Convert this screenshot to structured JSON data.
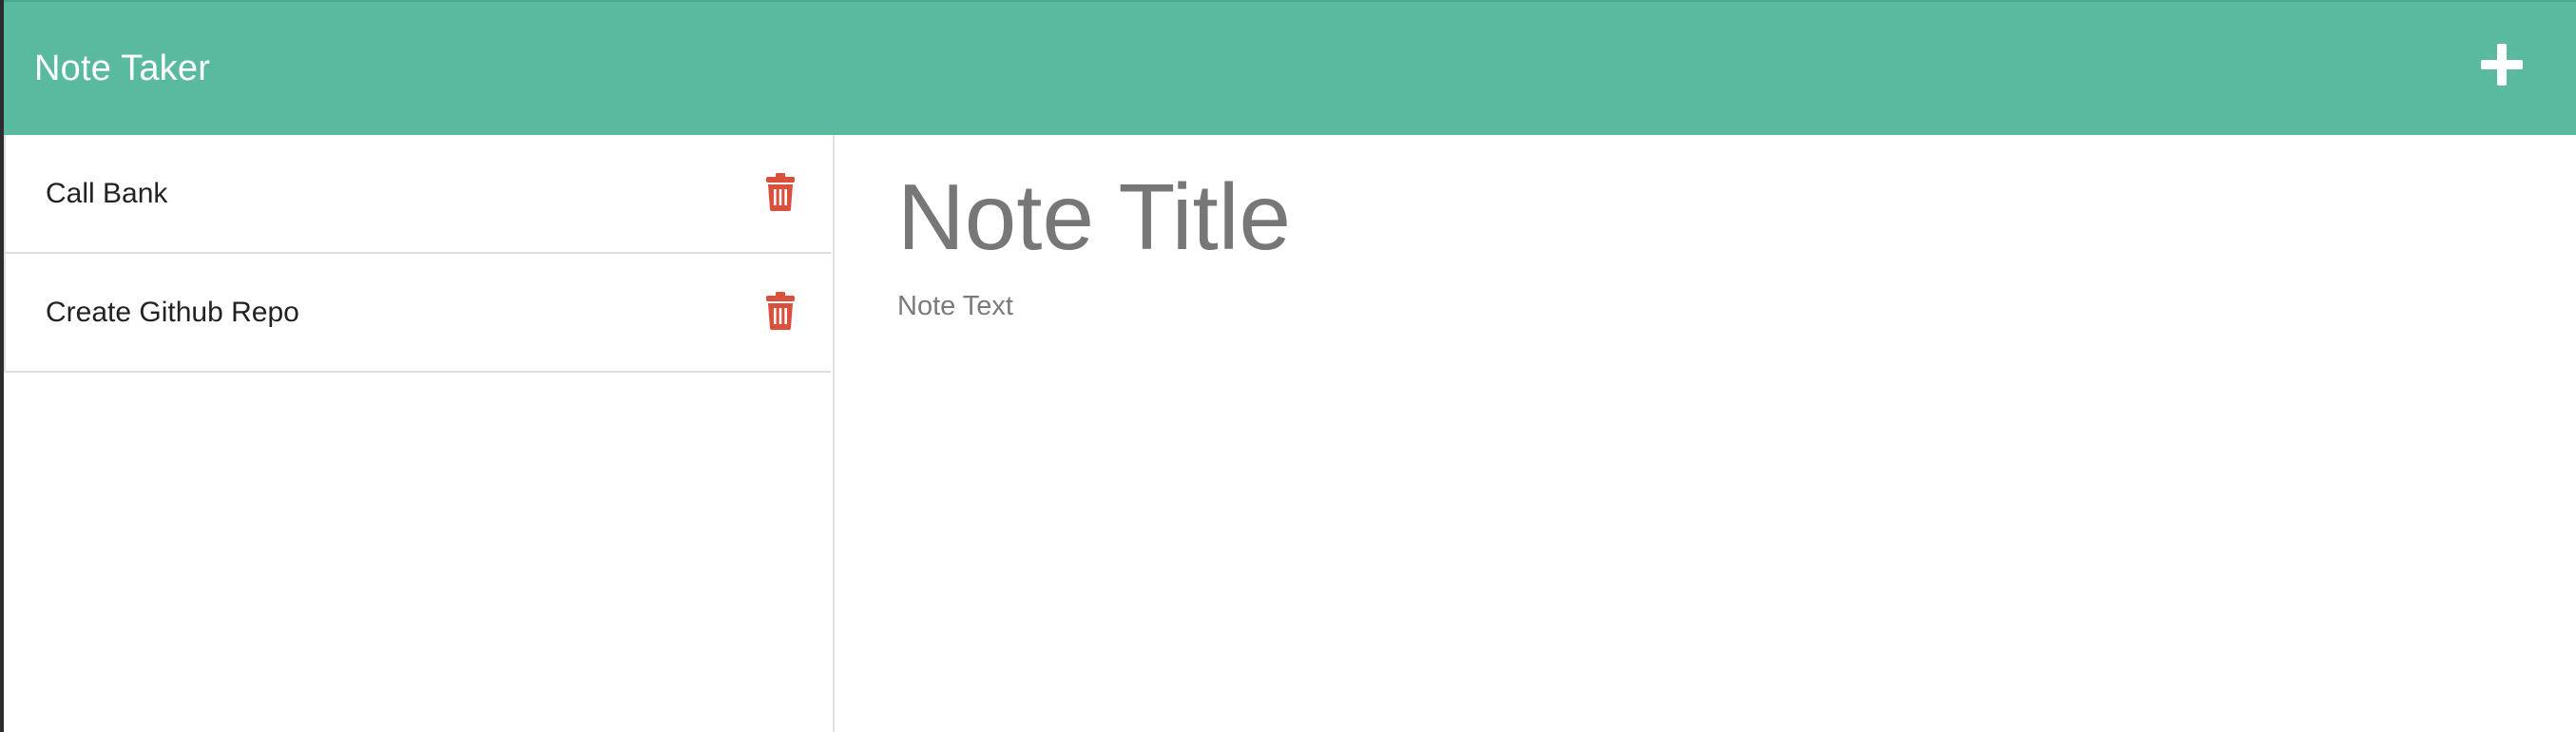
{
  "header": {
    "brand": "Note Taker",
    "new_note_icon": "plus-icon",
    "background_color": "#5aba9f"
  },
  "sidebar": {
    "notes": [
      {
        "title": "Call Bank",
        "delete_icon": "trash-icon"
      },
      {
        "title": "Create Github Repo",
        "delete_icon": "trash-icon"
      }
    ],
    "delete_icon_color": "#d9503d"
  },
  "editor": {
    "title_placeholder": "Note Title",
    "text_placeholder": "Note Text"
  }
}
